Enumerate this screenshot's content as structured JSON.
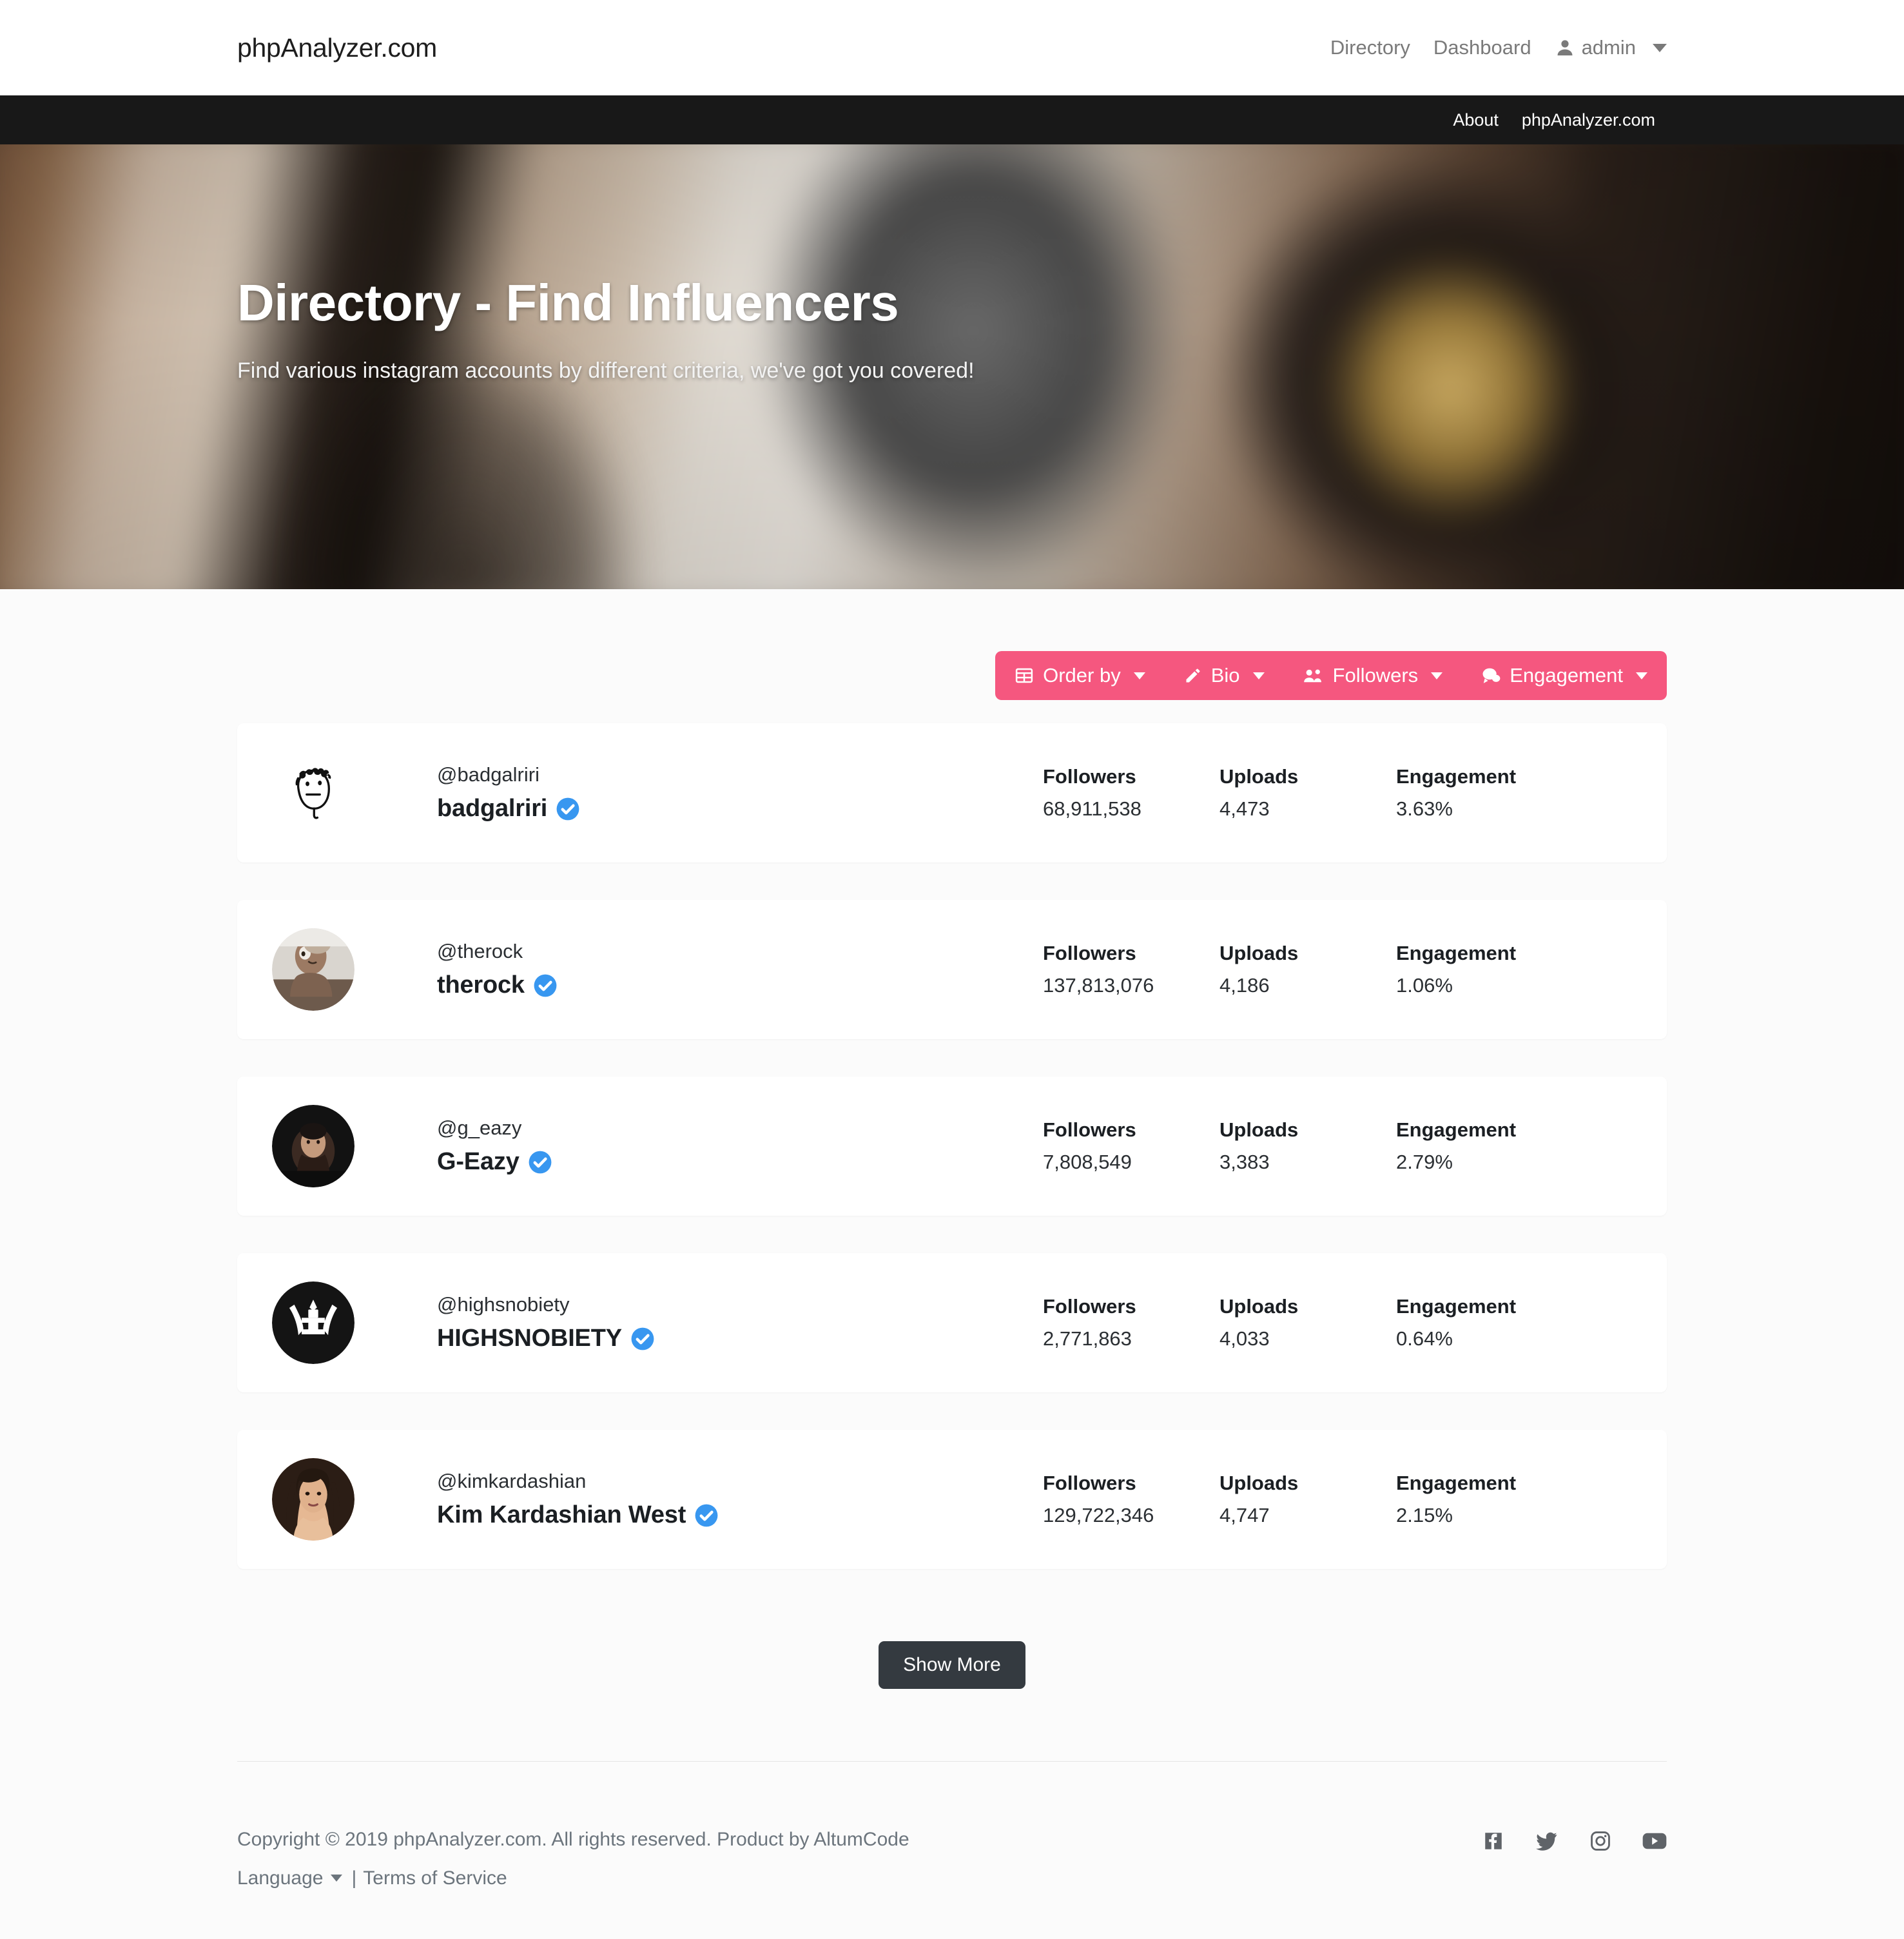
{
  "colors": {
    "accent_pink": "#f5577f",
    "dark_nav": "#181818",
    "dark_button": "#343a40",
    "verified_blue": "#3897f0",
    "muted_text": "#6c757d",
    "page_bg": "#fbfbfb"
  },
  "topnav": {
    "brand": "phpAnalyzer.com",
    "links": [
      {
        "label": "Directory",
        "name": "nav-link-directory"
      },
      {
        "label": "Dashboard",
        "name": "nav-link-dashboard"
      }
    ],
    "user": {
      "name": "admin",
      "icon": "user-icon",
      "caret": "chevron-down-icon"
    }
  },
  "darknav": {
    "links": [
      {
        "label": "About",
        "name": "darknav-link-about"
      },
      {
        "label": "phpAnalyzer.com",
        "name": "darknav-link-phpanalyzer"
      }
    ]
  },
  "hero": {
    "title": "Directory - Find Influencers",
    "subtitle": "Find various instagram accounts by different criteria, we've got you covered!"
  },
  "filterbar": {
    "buttons": [
      {
        "label": "Order by",
        "icon": "table-icon",
        "name": "filter-order-by"
      },
      {
        "label": "Bio",
        "icon": "pencil-icon",
        "name": "filter-bio"
      },
      {
        "label": "Followers",
        "icon": "users-icon",
        "name": "filter-followers"
      },
      {
        "label": "Engagement",
        "icon": "comments-icon",
        "name": "filter-engagement"
      }
    ]
  },
  "stat_labels": {
    "followers": "Followers",
    "uploads": "Uploads",
    "engagement": "Engagement"
  },
  "influencers": [
    {
      "handle": "@badgalriri",
      "fullname": "badgalriri",
      "verified": true,
      "followers": "68,911,538",
      "uploads": "4,473",
      "engagement": "3.63%",
      "avatar": "doodle-face-avatar"
    },
    {
      "handle": "@therock",
      "fullname": "therock",
      "verified": true,
      "followers": "137,813,076",
      "uploads": "4,186",
      "engagement": "1.06%",
      "avatar": "photo-avatar-therock"
    },
    {
      "handle": "@g_eazy",
      "fullname": "G-Eazy",
      "verified": true,
      "followers": "7,808,549",
      "uploads": "3,383",
      "engagement": "2.79%",
      "avatar": "photo-avatar-geazy"
    },
    {
      "handle": "@highsnobiety",
      "fullname": "HIGHSNOBIETY",
      "verified": true,
      "followers": "2,771,863",
      "uploads": "4,033",
      "engagement": "0.64%",
      "avatar": "crown-logo-avatar"
    },
    {
      "handle": "@kimkardashian",
      "fullname": "Kim Kardashian West",
      "verified": true,
      "followers": "129,722,346",
      "uploads": "4,747",
      "engagement": "2.15%",
      "avatar": "photo-avatar-kimkardashian"
    }
  ],
  "show_more": {
    "label": "Show More"
  },
  "footer": {
    "copyright": "Copyright © 2019 phpAnalyzer.com. All rights reserved. Product by AltumCode",
    "language_label": "Language",
    "separator": "|",
    "terms_label": "Terms of Service",
    "social": [
      {
        "name": "facebook-icon",
        "label": "Facebook"
      },
      {
        "name": "twitter-icon",
        "label": "Twitter"
      },
      {
        "name": "instagram-icon",
        "label": "Instagram"
      },
      {
        "name": "youtube-icon",
        "label": "YouTube"
      }
    ]
  }
}
